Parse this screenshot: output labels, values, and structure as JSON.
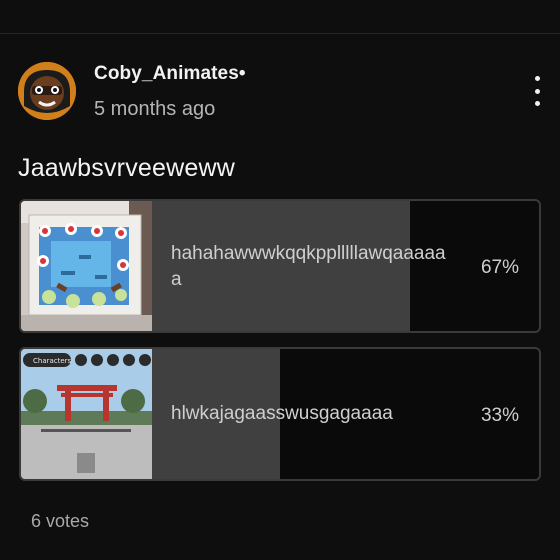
{
  "post": {
    "username": "Coby_Animates•",
    "timestamp": "5 months ago",
    "title": "Jaawbsvrveeweww",
    "avatar_icon": "character-face-avatar",
    "menu_icon": "kebab-menu-icon"
  },
  "poll": {
    "options": [
      {
        "label": "hahahawwwkqqkpplllllawqaaaaaa",
        "percent_text": "67%",
        "percent": 67,
        "image": "cake-photo-thumbnail"
      },
      {
        "label": "hlwkajagaasswusgagaaaa",
        "percent_text": "33%",
        "percent": 33,
        "image": "game-screenshot-thumbnail",
        "image_text": "Characters"
      }
    ],
    "votes_text": "6 votes"
  },
  "colors": {
    "background": "#0e0e0e",
    "option_fill": "#404040",
    "option_border": "#3a3a3a"
  }
}
